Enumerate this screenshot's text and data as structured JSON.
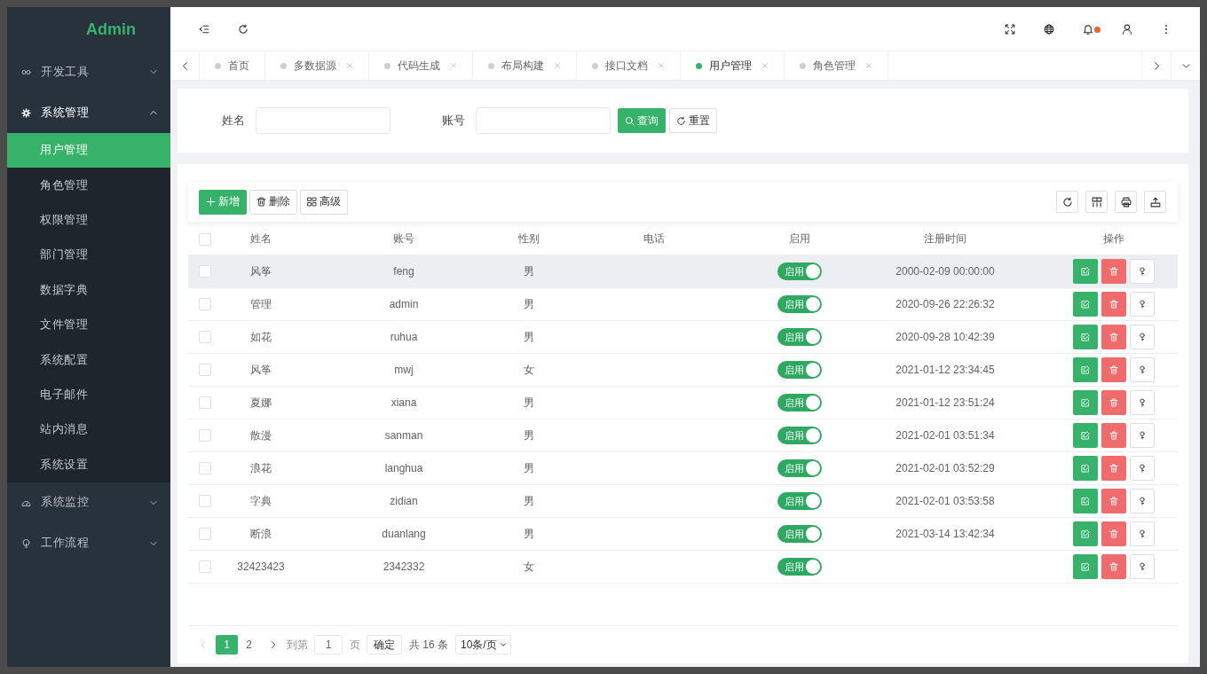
{
  "sidebar": {
    "logo": "Admin",
    "menu": [
      {
        "label": "开发工具",
        "expanded": false
      },
      {
        "label": "系统管理",
        "expanded": true,
        "children": [
          {
            "label": "用户管理",
            "selected": true
          },
          {
            "label": "角色管理",
            "selected": false
          },
          {
            "label": "权限管理",
            "selected": false
          },
          {
            "label": "部门管理",
            "selected": false
          },
          {
            "label": "数据字典",
            "selected": false
          },
          {
            "label": "文件管理",
            "selected": false
          },
          {
            "label": "系统配置",
            "selected": false
          },
          {
            "label": "电子邮件",
            "selected": false
          },
          {
            "label": "站内消息",
            "selected": false
          },
          {
            "label": "系统设置",
            "selected": false
          }
        ]
      },
      {
        "label": "系统监控",
        "expanded": false
      },
      {
        "label": "工作流程",
        "expanded": false
      }
    ]
  },
  "topbar": {
    "notification_dot": true
  },
  "tabs": [
    {
      "label": "首页",
      "selected": false,
      "closable": false
    },
    {
      "label": "多数据源",
      "selected": false,
      "closable": true
    },
    {
      "label": "代码生成",
      "selected": false,
      "closable": true
    },
    {
      "label": "布局构建",
      "selected": false,
      "closable": true
    },
    {
      "label": "接口文档",
      "selected": false,
      "closable": true
    },
    {
      "label": "用户管理",
      "selected": true,
      "closable": true
    },
    {
      "label": "角色管理",
      "selected": false,
      "closable": true
    }
  ],
  "search_form": {
    "fields": [
      {
        "label": "姓名"
      },
      {
        "label": "账号"
      }
    ],
    "buttons": [
      {
        "label": "查询",
        "kind": "primary"
      },
      {
        "label": "重置",
        "kind": "default"
      }
    ]
  },
  "toolbar": {
    "buttons": [
      {
        "label": "新增",
        "kind": "primary"
      },
      {
        "label": "删除",
        "kind": "default"
      },
      {
        "label": "高级",
        "kind": "default"
      }
    ]
  },
  "table": {
    "select_all": false,
    "columns": [
      "姓名",
      "账号",
      "性别",
      "电话",
      "启用",
      "注册时间",
      "操作"
    ],
    "rows": [
      {
        "checked": false,
        "highlighted": true,
        "name": "风筝",
        "account": "feng",
        "gender": "男",
        "enabled": true,
        "switch_label": "启用",
        "registered": "2000-02-09 00:00:00"
      },
      {
        "checked": false,
        "highlighted": false,
        "name": "管理",
        "account": "admin",
        "gender": "男",
        "enabled": true,
        "switch_label": "启用",
        "registered": "2020-09-26 22:26:32"
      },
      {
        "checked": false,
        "highlighted": false,
        "name": "如花",
        "account": "ruhua",
        "gender": "男",
        "enabled": true,
        "switch_label": "启用",
        "registered": "2020-09-28 10:42:39"
      },
      {
        "checked": false,
        "highlighted": false,
        "name": "风筝",
        "account": "mwj",
        "gender": "女",
        "enabled": true,
        "switch_label": "启用",
        "registered": "2021-01-12 23:34:45"
      },
      {
        "checked": false,
        "highlighted": false,
        "name": "夏娜",
        "account": "xiana",
        "gender": "男",
        "enabled": true,
        "switch_label": "启用",
        "registered": "2021-01-12 23:51:24"
      },
      {
        "checked": false,
        "highlighted": false,
        "name": "散漫",
        "account": "sanman",
        "gender": "男",
        "enabled": true,
        "switch_label": "启用",
        "registered": "2021-02-01 03:51:34"
      },
      {
        "checked": false,
        "highlighted": false,
        "name": "浪花",
        "account": "langhua",
        "gender": "男",
        "enabled": true,
        "switch_label": "启用",
        "registered": "2021-02-01 03:52:29"
      },
      {
        "checked": false,
        "highlighted": false,
        "name": "字典",
        "account": "zidian",
        "gender": "男",
        "enabled": true,
        "switch_label": "启用",
        "registered": "2021-02-01 03:53:58"
      },
      {
        "checked": false,
        "highlighted": false,
        "name": "断浪",
        "account": "duanlang",
        "gender": "男",
        "enabled": true,
        "switch_label": "启用",
        "registered": "2021-03-14 13:42:34"
      },
      {
        "checked": false,
        "highlighted": false,
        "name": "32423423",
        "account": "2342332",
        "gender": "女",
        "enabled": true,
        "switch_label": "启用"
      }
    ]
  },
  "pagination": {
    "prev_disabled": true,
    "next_disabled": false,
    "pages": [
      {
        "label": "1",
        "selected": true
      },
      {
        "label": "2",
        "selected": false
      }
    ],
    "goto_label": "到第",
    "goto_value": "1",
    "goto_suffix": "页",
    "confirm": "确定",
    "total": "共 16 条",
    "page_size": "10条/页"
  }
}
